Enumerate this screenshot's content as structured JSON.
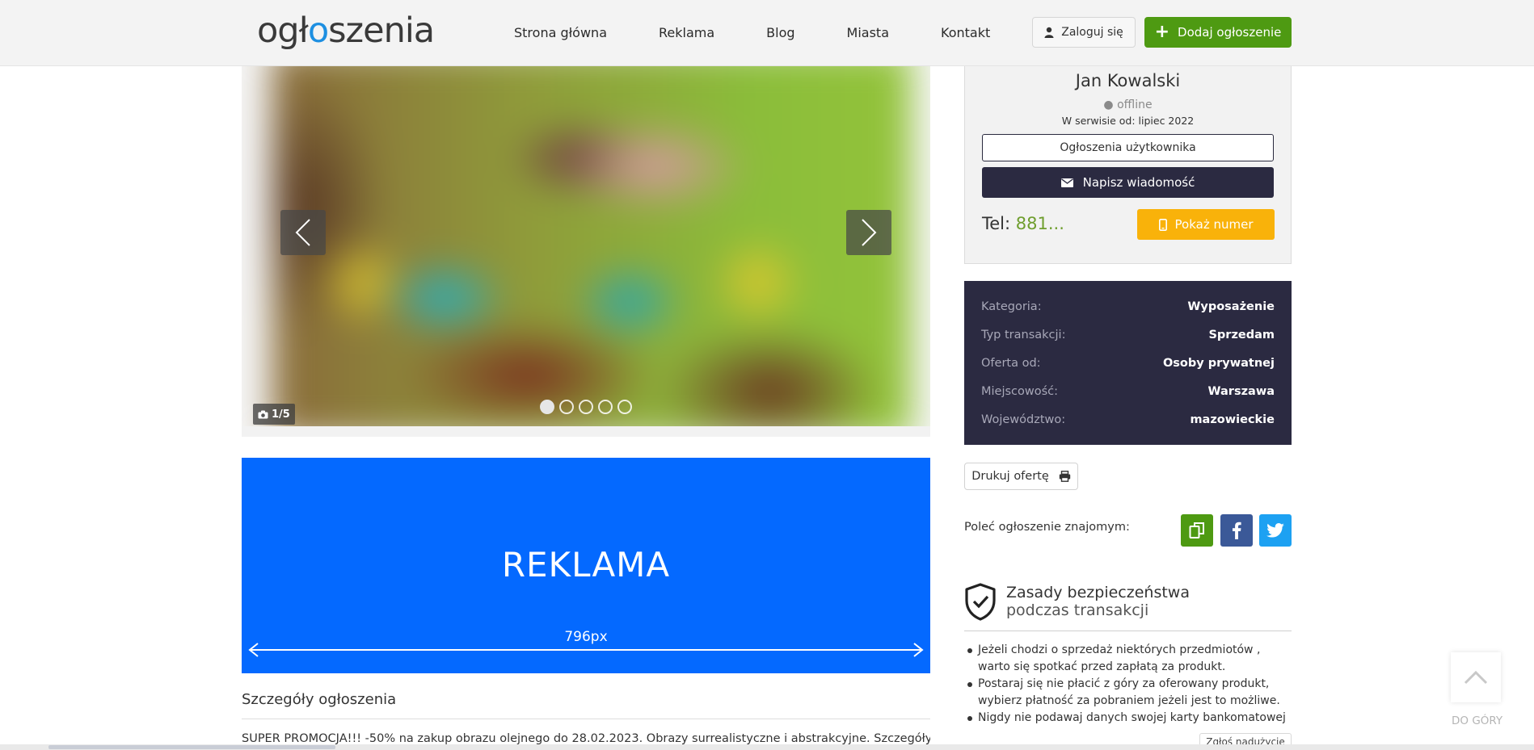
{
  "header": {
    "logo": {
      "before": "ogł",
      "q": "o",
      "after": "szenia"
    },
    "nav": [
      "Strona główna",
      "Reklama",
      "Blog",
      "Miasta",
      "Kontakt"
    ],
    "login_label": "Zaloguj się",
    "add_label": "Dodaj ogłoszenie"
  },
  "gallery": {
    "counter": "1/5",
    "current_index": 1,
    "total": 5
  },
  "ad": {
    "title": "REKLAMA",
    "size": "796px"
  },
  "details": {
    "title": "Szczegóły ogłoszenia",
    "text": "SUPER PROMOCJA!!! -50% na zakup obrazu olejnego do 28.02.2023. Obrazy surrealistyczne i abstrakcyjne. Szczegóły na"
  },
  "seller": {
    "name": "Jan Kowalski",
    "status": "● offline",
    "since": "W serwisie od: lipiec 2022",
    "user_ads_label": "Ogłoszenia użytkownika",
    "message_label": "Napisz wiadomość",
    "phone_prefix": "Tel: ",
    "phone_value": "881...",
    "show_number_label": "Pokaż numer"
  },
  "attributes": [
    {
      "label": "Kategoria:",
      "value": "Wyposażenie"
    },
    {
      "label": "Typ transakcji:",
      "value": "Sprzedam"
    },
    {
      "label": "Oferta od:",
      "value": "Osoby prywatnej"
    },
    {
      "label": "Miejscowość:",
      "value": "Warszawa"
    },
    {
      "label": "Województwo:",
      "value": "mazowieckie"
    }
  ],
  "actions": {
    "print_label": "Drukuj ofertę",
    "share_label": "Poleć ogłoszenie znajomym:"
  },
  "safety": {
    "title": "Zasady bezpieczeństwa",
    "subtitle": "podczas transakcji",
    "items": [
      "Jeżeli chodzi o sprzedaż niektórych przedmiotów , warto się spotkać przed zapłatą za produkt.",
      "Postaraj się nie płacić z góry za oferowany produkt, wybierz płatność za pobraniem jeżeli jest to możliwe.",
      "Nigdy nie podawaj danych swojej karty bankomatowej"
    ],
    "report_label": "Zgłoś nadużycie"
  },
  "back_to_top_label": "DO GÓRY",
  "colors": {
    "accent_green": "#4e9a12",
    "dark_navy": "#2b2a41",
    "ad_blue": "#0469ff",
    "yellow": "#f9b20a",
    "facebook": "#3b5998",
    "twitter": "#1da1f2"
  },
  "icons": [
    "user-icon",
    "plus-icon",
    "chevron-left-icon",
    "chevron-right-icon",
    "camera-icon",
    "envelope-icon",
    "mobile-phone-icon",
    "printer-icon",
    "copy-icon",
    "facebook-icon",
    "twitter-icon",
    "shield-check-icon",
    "chevron-up-icon"
  ]
}
